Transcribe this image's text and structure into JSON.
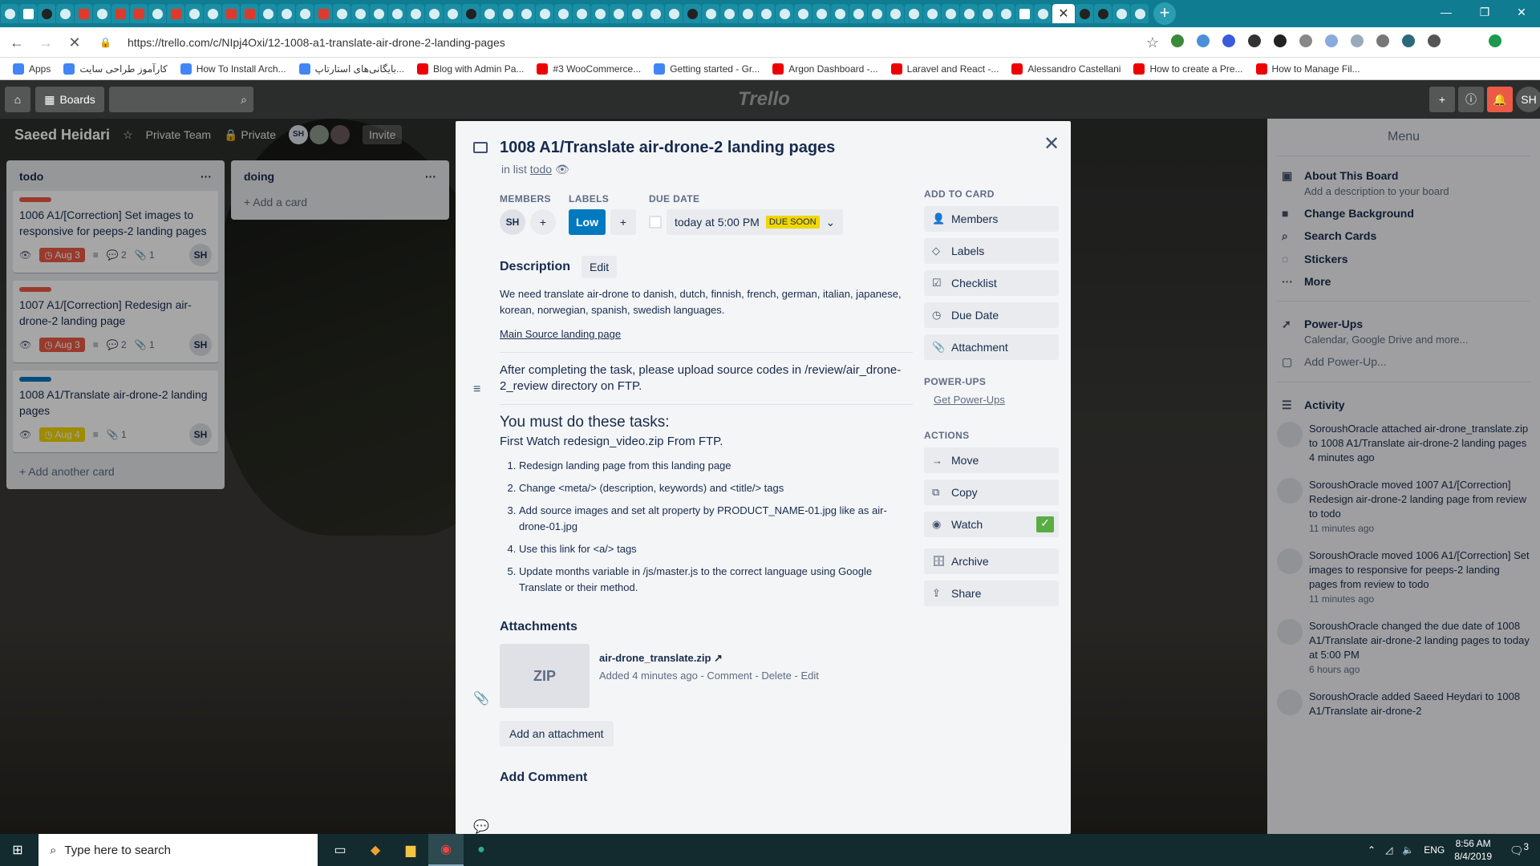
{
  "browser": {
    "url": "https://trello.com/c/NIpj4Oxi/12-1008-a1-translate-air-drone-2-landing-pages",
    "close_tab": "✕",
    "new_tab": "+"
  },
  "bookmarks": [
    "Apps",
    "کارآموز طراحی سایت",
    "How To Install Arch...",
    "بایگانی‌های استارتاپ...",
    "Blog with Admin Pa...",
    "#3 WooCommerce...",
    "Getting started - Gr...",
    "Argon Dashboard -...",
    "Laravel and React -...",
    "Alessandro Castellani",
    "How to create a Pre...",
    "How to Manage Fil..."
  ],
  "trello": {
    "boards_label": "Boards",
    "logo": "Trello",
    "board_title": "Saeed Heidari",
    "team": "Private Team",
    "visibility": "Private",
    "invite": "Invite",
    "avatar_initials": "SH"
  },
  "lists": [
    {
      "title": "todo",
      "cards": [
        {
          "text": "1006 A1/[Correction] Set images to responsive for peeps-2 landing pages",
          "due": "Aug 3",
          "comments": "2",
          "attach": "1",
          "member": "SH"
        },
        {
          "text": "1007 A1/[Correction] Redesign air-drone-2 landing page",
          "due": "Aug 3",
          "comments": "2",
          "attach": "1",
          "member": "SH"
        },
        {
          "text": "1008 A1/Translate air-drone-2 landing pages",
          "due": "Aug 4",
          "comments": "",
          "attach": "1",
          "member": "SH"
        }
      ],
      "add": "+ Add another card"
    },
    {
      "title": "doing",
      "cards": [],
      "add": "+ Add a card"
    }
  ],
  "modal": {
    "title": "1008 A1/Translate air-drone-2 landing pages",
    "in_list_prefix": "in list",
    "in_list": "todo",
    "members_label": "MEMBERS",
    "labels_label": "LABELS",
    "due_label": "DUE DATE",
    "member": "SH",
    "label_low": "Low",
    "due_text": "today at 5:00 PM",
    "due_badge": "DUE SOON",
    "description_label": "Description",
    "edit": "Edit",
    "desc1": "We need translate air-drone to danish, dutch, finnish, french, german, italian, japanese, korean, norwegian, spanish, swedish languages.",
    "desc_link": "Main Source landing page",
    "upload_note": "After completing the task, please upload source codes in /review/air_drone-2_review directory on FTP.",
    "tasks_heading": "You must do these tasks:",
    "first_watch": "First Watch redesign_video.zip From FTP.",
    "tasks": [
      "Redesign landing page from this landing page",
      "Change <meta/> (description, keywords) and <title/> tags",
      "Add source images and set alt property by PRODUCT_NAME-01.jpg like as air-drone-01.jpg",
      "Use this link for <a/> tags",
      "Update months variable in /js/master.js to the correct language using Google Translate or their method."
    ],
    "attachments_label": "Attachments",
    "file_thumb": "ZIP",
    "file_name": "air-drone_translate.zip ↗",
    "file_meta": "Added 4 minutes ago - Comment - Delete - Edit",
    "add_attachment": "Add an attachment",
    "add_comment": "Add Comment",
    "add_to_card_label": "ADD TO CARD",
    "add_to_card": [
      {
        "icon": "👤",
        "label": "Members"
      },
      {
        "icon": "◇",
        "label": "Labels"
      },
      {
        "icon": "☑",
        "label": "Checklist"
      },
      {
        "icon": "◷",
        "label": "Due Date"
      },
      {
        "icon": "📎",
        "label": "Attachment"
      }
    ],
    "powerups_label": "POWER-UPS",
    "get_powerups": "Get Power-Ups",
    "actions_label": "ACTIONS",
    "actions": [
      {
        "icon": "→",
        "label": "Move"
      },
      {
        "icon": "⧉",
        "label": "Copy"
      },
      {
        "icon": "◉",
        "label": "Watch"
      },
      {
        "icon": "🗄",
        "label": "Archive"
      },
      {
        "icon": "⇪",
        "label": "Share"
      }
    ]
  },
  "menu": {
    "title": "Menu",
    "items": [
      {
        "label": "About This Board",
        "sub": "Add a description to your board"
      },
      {
        "label": "Change Background",
        "sub": ""
      },
      {
        "label": "Search Cards",
        "sub": ""
      },
      {
        "label": "Stickers",
        "sub": ""
      },
      {
        "label": "More",
        "sub": ""
      }
    ],
    "powerups": {
      "label": "Power-Ups",
      "sub": "Calendar, Google Drive and more..."
    },
    "add_powerup": "Add Power-Up...",
    "activity": "Activity",
    "activity_items": [
      {
        "text": "SoroushOracle attached air-drone_translate.zip to 1008 A1/Translate air-drone-2 landing pages 4 minutes ago",
        "time": ""
      },
      {
        "text": "SoroushOracle moved 1007 A1/[Correction] Redesign air-drone-2 landing page from review to todo",
        "time": "11 minutes ago"
      },
      {
        "text": "SoroushOracle moved 1006 A1/[Correction] Set images to responsive for peeps-2 landing pages from review to todo",
        "time": "11 minutes ago"
      },
      {
        "text": "SoroushOracle changed the due date of 1008 A1/Translate air-drone-2 landing pages to today at 5:00 PM",
        "time": "6 hours ago"
      },
      {
        "text": "SoroushOracle added Saeed Heydari to 1008 A1/Translate air-drone-2",
        "time": ""
      }
    ]
  },
  "taskbar": {
    "search": "Type here to search",
    "time": "8:56 AM",
    "date": "8/4/2019",
    "lang": "ENG",
    "notif_count": "3"
  }
}
